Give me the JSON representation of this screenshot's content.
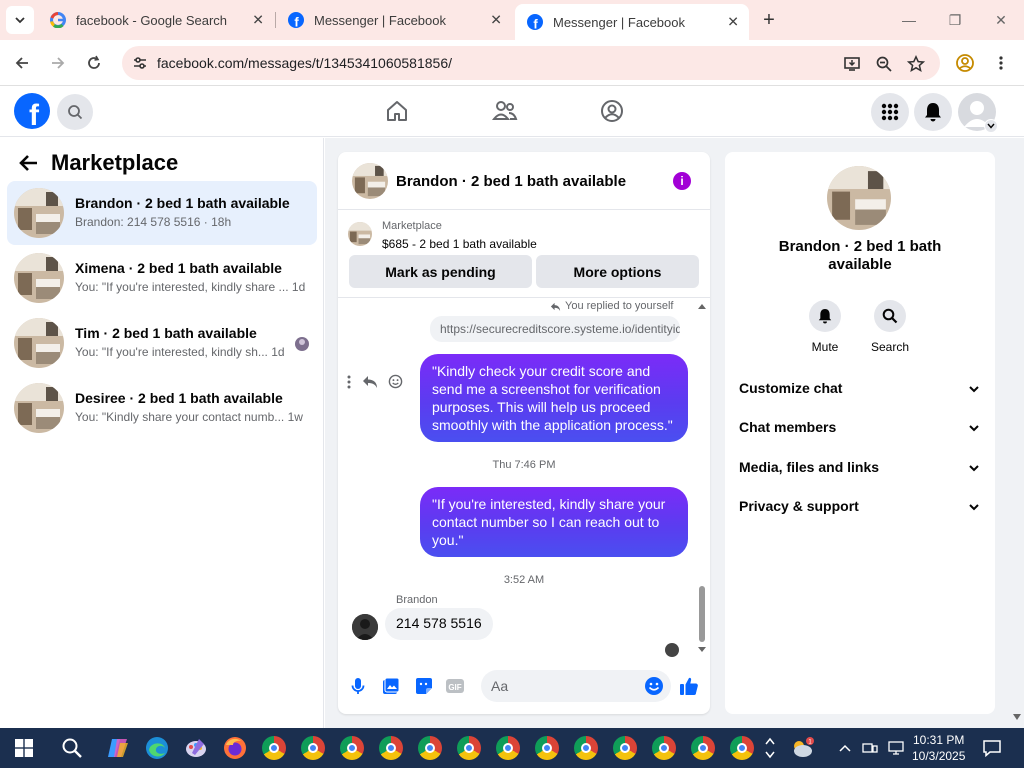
{
  "browser": {
    "tabs": [
      {
        "title": "facebook - Google Search",
        "icon": "google-icon"
      },
      {
        "title": "Messenger | Facebook",
        "icon": "facebook-icon"
      },
      {
        "title": "Messenger | Facebook",
        "icon": "facebook-icon",
        "active": true
      }
    ],
    "url": "facebook.com/messages/t/1345341060581856/"
  },
  "left_pane": {
    "title": "Marketplace",
    "conversations": [
      {
        "name": "Brandon · 2 bed 1 bath available",
        "preview": "Brandon: 214 578 5516 · 18h",
        "active": true
      },
      {
        "name": "Ximena · 2 bed 1 bath available",
        "preview": "You: \"If you're interested, kindly share ...  1d"
      },
      {
        "name": "Tim · 2 bed 1 bath available",
        "preview": "You: \"If you're interested, kindly sh...   1d"
      },
      {
        "name": "Desiree · 2 bed 1 bath available",
        "preview": "You: \"Kindly share your contact numb...  1w"
      }
    ]
  },
  "chat": {
    "title": "Brandon · 2 bed 1 bath available",
    "marketplace_label": "Marketplace",
    "listing": "$685 - 2 bed 1 bath available",
    "mark_pending": "Mark as pending",
    "more_options": "More options",
    "replied_note": "You replied to yourself",
    "link_preview": "https://securecreditscore.systeme.io/identityiq",
    "bubble1": "\"Kindly check your credit score and send me a screenshot for verification purposes. This will help us proceed smoothly with the application process.\"",
    "ts1": "Thu 7:46 PM",
    "bubble2": "\"If you're interested, kindly share your contact number so I can reach out to you.\"",
    "ts2": "3:52 AM",
    "sender": "Brandon",
    "incoming": "214 578 5516",
    "input_placeholder": "Aa"
  },
  "info_pane": {
    "name": "Brandon · 2 bed 1 bath available",
    "mute": "Mute",
    "search": "Search",
    "sections": [
      "Customize chat",
      "Chat members",
      "Media, files and links",
      "Privacy & support"
    ]
  },
  "taskbar": {
    "time": "10:31 PM",
    "date": "10/3/2025"
  },
  "colors": {
    "facebook_blue": "#0866ff",
    "bubble_purple": "#6a35f5",
    "active_row": "#e7f0fd",
    "tab_bar": "#fce8e6",
    "taskbar": "#1b2f4f"
  }
}
